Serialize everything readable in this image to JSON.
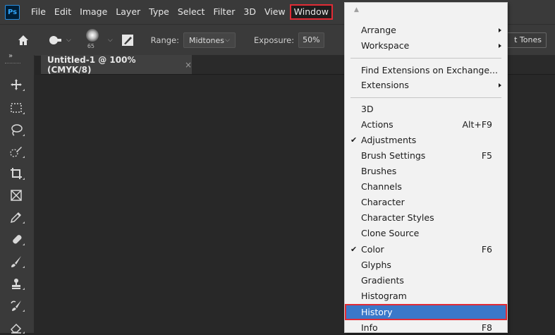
{
  "app": {
    "logo": "Ps"
  },
  "menubar": {
    "items": [
      "File",
      "Edit",
      "Image",
      "Layer",
      "Type",
      "Select",
      "Filter",
      "3D",
      "View",
      "Window"
    ]
  },
  "options": {
    "brush_size": "65",
    "range_label": "Range:",
    "range_value": "Midtones",
    "exposure_label": "Exposure:",
    "exposure_value": "50%",
    "protect_tones_label": "t Tones"
  },
  "document": {
    "tab_title": "Untitled-1 @ 100% (CMYK/8)",
    "close_glyph": "×"
  },
  "toolbar": {
    "collapse_glyph": "»"
  },
  "window_menu": {
    "scroll_glyph": "▲",
    "items": [
      {
        "label": "Arrange",
        "submenu": true
      },
      {
        "label": "Workspace",
        "submenu": true
      },
      {
        "label": "Find Extensions on Exchange..."
      },
      {
        "label": "Extensions",
        "submenu": true
      },
      {
        "label": "3D"
      },
      {
        "label": "Actions",
        "shortcut": "Alt+F9"
      },
      {
        "label": "Adjustments",
        "checked": true
      },
      {
        "label": "Brush Settings",
        "shortcut": "F5"
      },
      {
        "label": "Brushes"
      },
      {
        "label": "Channels"
      },
      {
        "label": "Character"
      },
      {
        "label": "Character Styles"
      },
      {
        "label": "Clone Source"
      },
      {
        "label": "Color",
        "shortcut": "F6",
        "checked": true
      },
      {
        "label": "Glyphs"
      },
      {
        "label": "Gradients"
      },
      {
        "label": "Histogram"
      },
      {
        "label": "History",
        "highlighted": true
      },
      {
        "label": "Info",
        "shortcut": "F8"
      }
    ]
  },
  "colors": {
    "highlight": "#3a78c9",
    "annotation_red": "#e12b35",
    "ui_dark": "#3a3a3a",
    "canvas": "#282828"
  }
}
